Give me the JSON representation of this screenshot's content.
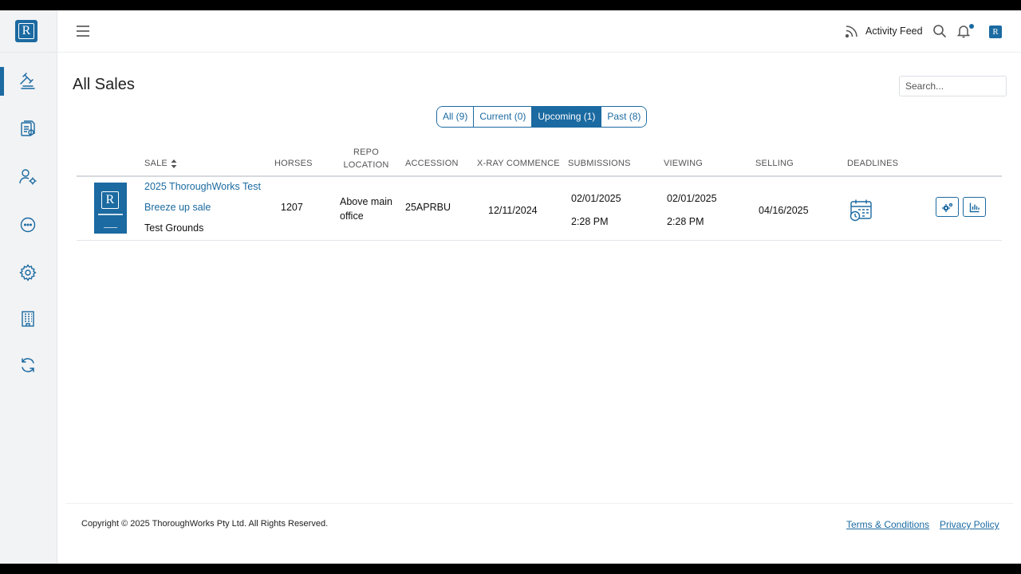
{
  "app": {
    "logo_letter": "R",
    "brand_color": "#1b6aa1"
  },
  "header": {
    "activity_feed_label": "Activity Feed",
    "avatar_letter": "R",
    "icons": [
      "menu-icon",
      "rss-icon",
      "search-icon",
      "bell-icon"
    ]
  },
  "sidebar": {
    "items": [
      {
        "name": "gavel-icon",
        "active": true
      },
      {
        "name": "document-icon",
        "active": false
      },
      {
        "name": "user-settings-icon",
        "active": false
      },
      {
        "name": "chat-icon",
        "active": false
      },
      {
        "name": "gear-icon",
        "active": false
      },
      {
        "name": "building-icon",
        "active": false
      },
      {
        "name": "refresh-icon",
        "active": false
      }
    ]
  },
  "page": {
    "title": "All Sales",
    "search_placeholder": "Search..."
  },
  "filters": [
    {
      "label": "All (9)",
      "active": false
    },
    {
      "label": "Current (0)",
      "active": false
    },
    {
      "label": "Upcoming (1)",
      "active": true
    },
    {
      "label": "Past (8)",
      "active": false
    }
  ],
  "table": {
    "headers": {
      "sale": "SALE",
      "horses": "HORSES",
      "repo_location_1": "REPO",
      "repo_location_2": "LOCATION",
      "accession": "ACCESSION",
      "xray": "X-RAY COMMENCE",
      "submissions": "SUBMISSIONS",
      "viewing": "VIEWING",
      "selling": "SELLING",
      "deadlines": "DEADLINES"
    },
    "rows": [
      {
        "sale_name": "2025 ThoroughWorks Test",
        "sale_type": "Breeze up sale",
        "venue": "Test Grounds",
        "horses": "1207",
        "repo_location_1": "Above main",
        "repo_location_2": "office",
        "accession": "25APRBU",
        "xray_commence": "12/11/2024",
        "submissions_date": "02/01/2025",
        "submissions_time": "2:28 PM",
        "viewing_date": "02/01/2025",
        "viewing_time": "2:28 PM",
        "selling": "04/16/2025"
      }
    ]
  },
  "footer": {
    "copyright": "Copyright © 2025 ThoroughWorks Pty Ltd. All Rights Reserved.",
    "terms": "Terms & Conditions",
    "privacy": "Privacy Policy"
  }
}
